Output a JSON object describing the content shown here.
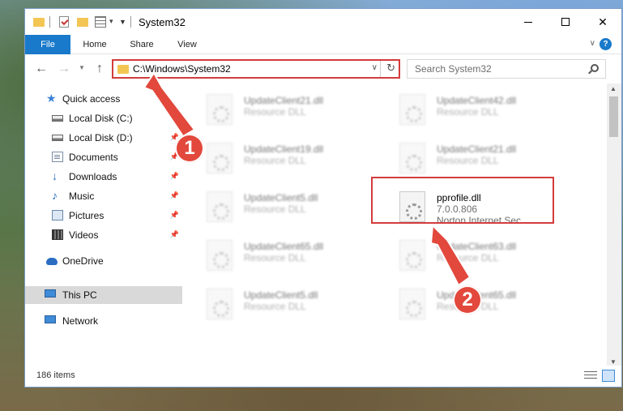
{
  "window": {
    "title": "System32",
    "buttons": {
      "minimize": "",
      "maximize": "",
      "close": "✕"
    }
  },
  "ribbon": {
    "tabs": [
      "File",
      "Home",
      "Share",
      "View"
    ],
    "help": "?"
  },
  "nav": {
    "back": "←",
    "forward": "→",
    "up": "↑",
    "address": "C:\\Windows\\System32",
    "search_placeholder": "Search System32"
  },
  "sidebar": {
    "items": [
      {
        "label": "Quick access",
        "icon": "star-icon",
        "pinned": false
      },
      {
        "label": "Local Disk (C:)",
        "icon": "drive-icon",
        "pinned": false
      },
      {
        "label": "Local Disk (D:)",
        "icon": "drive-icon",
        "pinned": true
      },
      {
        "label": "Documents",
        "icon": "documents-icon",
        "pinned": true
      },
      {
        "label": "Downloads",
        "icon": "downloads-icon",
        "pinned": true
      },
      {
        "label": "Music",
        "icon": "music-icon",
        "pinned": true
      },
      {
        "label": "Pictures",
        "icon": "pictures-icon",
        "pinned": true
      },
      {
        "label": "Videos",
        "icon": "videos-icon",
        "pinned": true
      },
      {
        "label": "OneDrive",
        "icon": "onedrive-icon",
        "pinned": false
      },
      {
        "label": "This PC",
        "icon": "this-pc-icon",
        "pinned": false,
        "selected": true
      },
      {
        "label": "Network",
        "icon": "network-icon",
        "pinned": false
      }
    ]
  },
  "files": {
    "left_column": [
      {
        "name": "UpdateClient21.dll",
        "type": "Resource DLL"
      },
      {
        "name": "UpdateClient19.dll",
        "type": "Resource DLL"
      },
      {
        "name": "UpdateClient5.dll",
        "type": "Resource DLL"
      },
      {
        "name": "UpdateClient65.dll",
        "type": "Resource DLL"
      },
      {
        "name": "UpdateClient5.dll",
        "type": "Resource DLL"
      }
    ],
    "right_column": [
      {
        "name": "UpdateClient42.dll",
        "type": "Resource DLL"
      },
      {
        "name": "UpdateClient21.dll",
        "type": "Resource DLL"
      },
      {
        "name": "UpdateClient63.dll",
        "type": "Resource DLL"
      },
      {
        "name": "UpdateClient65.dll",
        "type": "Resource DLL"
      }
    ],
    "highlighted": {
      "name": "pprofile.dll",
      "version": "7.0.0.806",
      "description": "Norton Internet Sec..."
    }
  },
  "status": {
    "item_count": "186 items"
  },
  "annotations": {
    "step1": "1",
    "step2": "2",
    "color": "#e2483c"
  },
  "colors": {
    "accent": "#1979ca",
    "highlight_border": "#d43c3c",
    "folder": "#f3c654"
  }
}
